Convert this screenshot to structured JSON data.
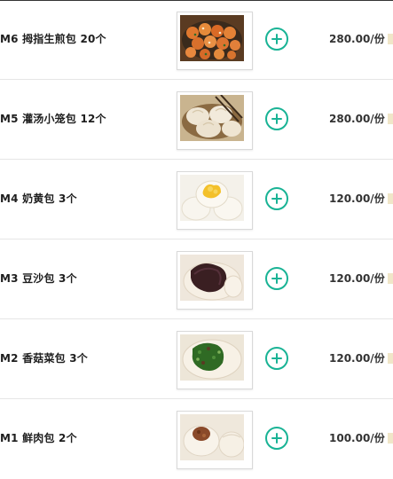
{
  "menu": {
    "items": [
      {
        "name": "M6 拇指生煎包 20个",
        "price": "280.00/份",
        "image": "pan-fried-buns"
      },
      {
        "name": "M5 灌汤小笼包 12个",
        "price": "280.00/份",
        "image": "soup-dumplings"
      },
      {
        "name": "M4 奶黄包 3个",
        "price": "120.00/份",
        "image": "custard-buns"
      },
      {
        "name": "M3 豆沙包 3个",
        "price": "120.00/份",
        "image": "red-bean-buns"
      },
      {
        "name": "M2 香菇菜包 3个",
        "price": "120.00/份",
        "image": "mushroom-vegetable-buns"
      },
      {
        "name": "M1 鲜肉包 2个",
        "price": "100.00/份",
        "image": "pork-buns"
      }
    ]
  },
  "colors": {
    "accent": "#19b395"
  }
}
